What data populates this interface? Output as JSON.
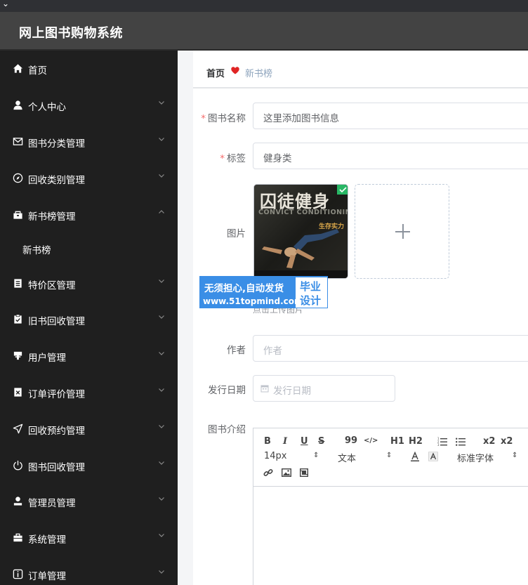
{
  "app": {
    "title": "网上图书购物系统"
  },
  "sidebar": {
    "items": [
      {
        "label": "首页",
        "icon": "home-icon",
        "has_arrow": false
      },
      {
        "label": "个人中心",
        "icon": "user-icon",
        "has_arrow": true
      },
      {
        "label": "图书分类管理",
        "icon": "mail-icon",
        "has_arrow": true
      },
      {
        "label": "回收类别管理",
        "icon": "compass-icon",
        "has_arrow": true
      },
      {
        "label": "新书榜管理",
        "icon": "sell-icon",
        "has_arrow": true,
        "expanded": true
      },
      {
        "label": "特价区管理",
        "icon": "notebook-icon",
        "has_arrow": true
      },
      {
        "label": "旧书回收管理",
        "icon": "clipboard-check-icon",
        "has_arrow": true
      },
      {
        "label": "用户管理",
        "icon": "stamp-icon",
        "has_arrow": true
      },
      {
        "label": "订单评价管理",
        "icon": "document-delete-icon",
        "has_arrow": true
      },
      {
        "label": "回收预约管理",
        "icon": "position-icon",
        "has_arrow": true
      },
      {
        "label": "图书回收管理",
        "icon": "power-icon",
        "has_arrow": true
      },
      {
        "label": "管理员管理",
        "icon": "admin-user-icon",
        "has_arrow": true
      },
      {
        "label": "系统管理",
        "icon": "suitcase-icon",
        "has_arrow": true
      },
      {
        "label": "订单管理",
        "icon": "info-icon",
        "has_arrow": true
      }
    ],
    "submenu": {
      "label": "新书榜"
    }
  },
  "breadcrumb": {
    "home": "首页",
    "current": "新书榜"
  },
  "form": {
    "name": {
      "label": "图书名称",
      "value": "这里添加图书信息"
    },
    "tag": {
      "label": "标签",
      "value": "健身类"
    },
    "picture": {
      "label": "图片",
      "upload_tip": "点击上传图片"
    },
    "author": {
      "label": "作者",
      "placeholder": "作者"
    },
    "date": {
      "label": "发行日期",
      "placeholder": "发行日期"
    },
    "intro": {
      "label": "图书介绍"
    }
  },
  "book_cover": {
    "title": "囚徒健身",
    "subtitle": "CONVICT CONDITIONING",
    "tagline": "生存实力"
  },
  "watermark": {
    "line1": "无须担心,自动发货",
    "line2": "www.51topmind.com",
    "box_top": "毕业",
    "box_bottom": "设计"
  },
  "editor": {
    "buttons": [
      "B",
      "I",
      "U",
      "S",
      "99",
      "</>",
      "H1",
      "H2",
      "ol",
      "ul",
      "x2",
      "x2"
    ],
    "font_size": "14px",
    "text_type": "文本",
    "font_family": "标准字体"
  },
  "colors": {
    "sidebar_bg": "#1f1f1f",
    "header_bg": "#434343",
    "required": "#f56c6c",
    "watermark_blue": "#3a8ee6"
  }
}
